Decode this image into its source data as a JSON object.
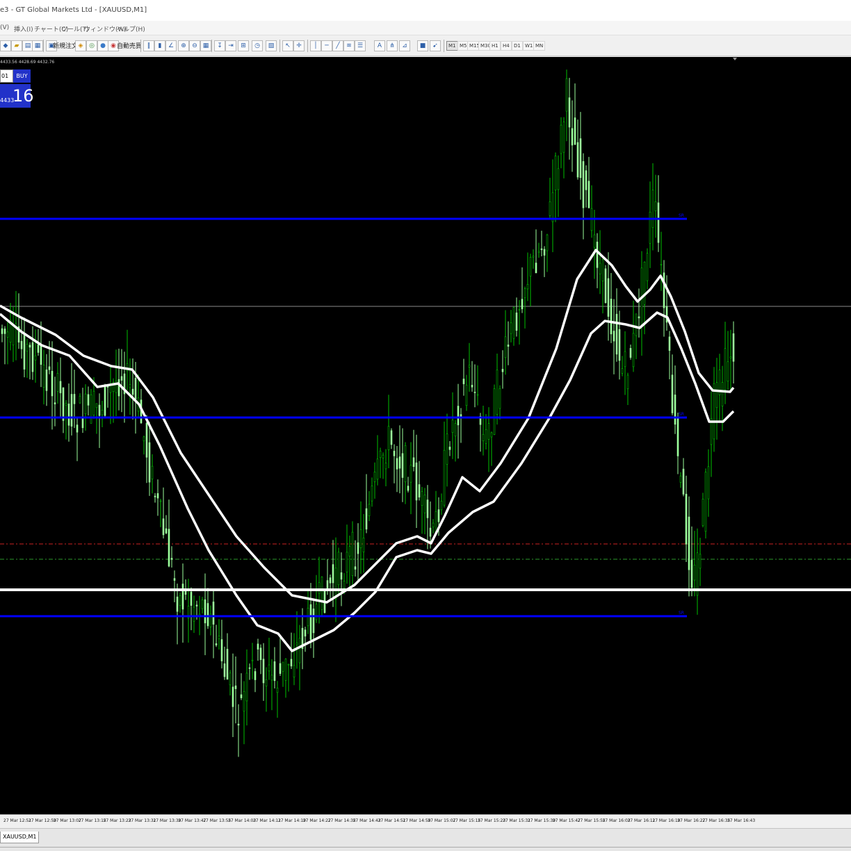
{
  "window": {
    "title": "e3 - GT Global Markets Ltd - [XAUUSD,M1]"
  },
  "menu": {
    "items": [
      "(V)",
      "挿入(I)",
      "チャート(C)",
      "ツール(T)",
      "ウィンドウ(W)",
      "ヘルプ(H)"
    ]
  },
  "toolbar": {
    "new_order_label": "新規注文",
    "auto_trade_label": "自動売買",
    "timeframes": [
      "M1",
      "M5",
      "M15",
      "M30",
      "H1",
      "H4",
      "D1",
      "W1",
      "MN"
    ],
    "active_timeframe": "M1"
  },
  "trade_panel": {
    "ohlc_text": "4433.56 4428.69 4432.76",
    "symbol_field": "01",
    "buy_label": "BUY",
    "price_small": "4433",
    "price_big": "16",
    "buy_color": "#2232c9"
  },
  "chart": {
    "symbol": "XAUUSD",
    "timeframe": "M1",
    "background": "#000000",
    "bull_color": "#00c000",
    "bear_color": "#9cff9c",
    "level_color": "#0000ff",
    "ma_color": "#ffffff",
    "level_tag": "SR",
    "time_labels": [
      "27 Mar 12:51",
      "27 Mar 12:59",
      "27 Mar 13:07",
      "27 Mar 13:15",
      "27 Mar 13:23",
      "27 Mar 13:31",
      "27 Mar 13:39",
      "27 Mar 13:47",
      "27 Mar 13:55",
      "27 Mar 14:03",
      "27 Mar 14:11",
      "27 Mar 14:19",
      "27 Mar 14:27",
      "27 Mar 14:35",
      "27 Mar 14:43",
      "27 Mar 14:51",
      "27 Mar 14:59",
      "27 Mar 15:07",
      "27 Mar 15:15",
      "27 Mar 15:23",
      "27 Mar 15:31",
      "27 Mar 15:39",
      "27 Mar 15:47",
      "27 Mar 15:55",
      "27 Mar 16:03",
      "27 Mar 16:11",
      "27 Mar 16:19",
      "27 Mar 16:27",
      "27 Mar 16:35",
      "27 Mar 16:43"
    ]
  },
  "tabs": [
    "XAUUSD,M1"
  ]
}
